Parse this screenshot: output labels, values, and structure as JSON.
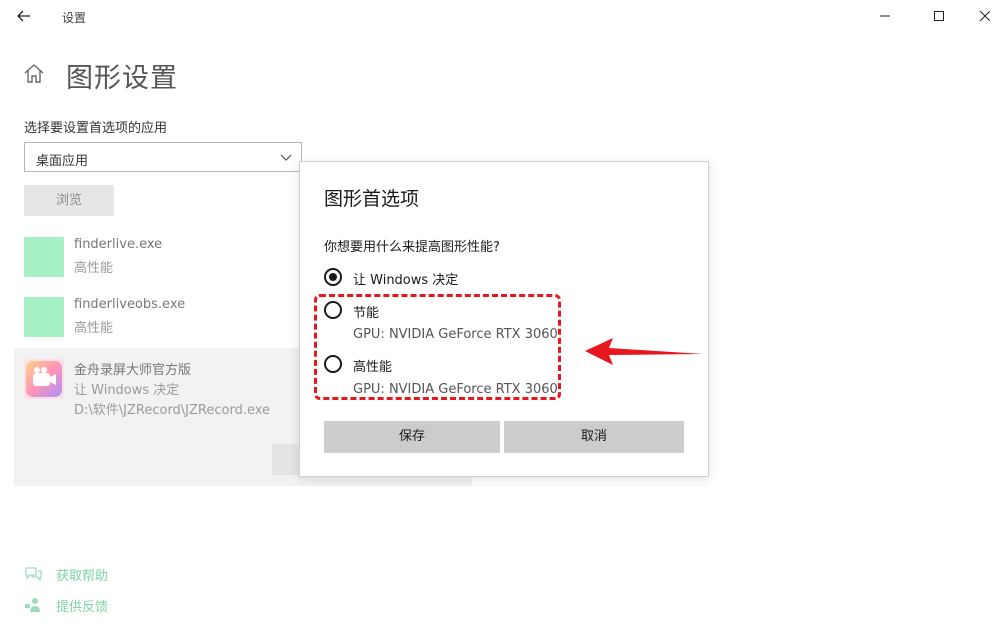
{
  "window": {
    "title": "设置",
    "minimize_icon": "minimize-icon",
    "maximize_icon": "maximize-icon",
    "close_icon": "close-icon",
    "back_icon": "back-arrow-icon"
  },
  "page": {
    "home_icon": "home-icon",
    "title": "图形设置",
    "select_label": "选择要设置首选项的应用",
    "app_type_value": "桌面应用",
    "browse_label": "浏览"
  },
  "apps": [
    {
      "name": "finderlive.exe",
      "preference": "高性能",
      "icon_color": "#a6f0c6"
    },
    {
      "name": "finderliveobs.exe",
      "preference": "高性能",
      "icon_color": "#a6f0c6"
    },
    {
      "name": "金舟录屏大师官方版",
      "preference": "让 Windows 决定",
      "path": "D:\\软件\\JZRecord\\JZRecord.exe",
      "icon": "camera-app-icon"
    }
  ],
  "dialog": {
    "title": "图形首选项",
    "question": "你想要用什么来提高图形性能?",
    "options": [
      {
        "label": "让 Windows 决定",
        "selected": true
      },
      {
        "label": "节能",
        "gpu": "GPU: NVIDIA GeForce RTX 3060",
        "selected": false
      },
      {
        "label": "高性能",
        "gpu": "GPU: NVIDIA GeForce RTX 3060",
        "selected": false
      }
    ],
    "save_label": "保存",
    "cancel_label": "取消"
  },
  "annotation": {
    "color": "#e8161e"
  },
  "footer": {
    "help_label": "获取帮助",
    "feedback_label": "提供反馈",
    "link_color": "#7fd3a4"
  }
}
